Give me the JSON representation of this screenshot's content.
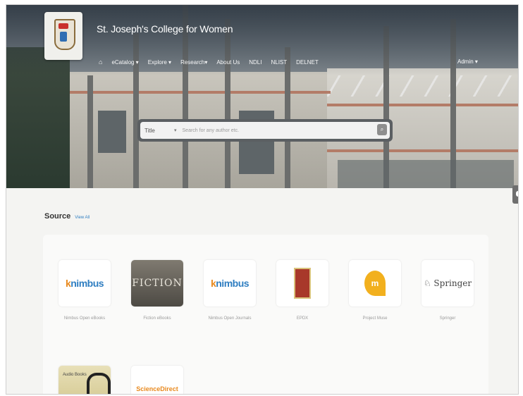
{
  "header": {
    "site_title": "St. Joseph's College for Women",
    "nav": [
      "eCatalog ▾",
      "Explore ▾",
      "Research▾",
      "About Us",
      "NDLI",
      "NLIST",
      "DELNET"
    ],
    "user_menu": "Admin ▾"
  },
  "search": {
    "field_label": "Title",
    "placeholder": "Search for any author etc."
  },
  "source": {
    "heading": "Source",
    "view_all": "View All",
    "items": [
      {
        "label": "Nimbus Open eBooks",
        "logo": "knimbus"
      },
      {
        "label": "Fiction eBooks",
        "logo": "FICTION"
      },
      {
        "label": "Nimbus Open Journals",
        "logo": "knimbus"
      },
      {
        "label": "EPDX",
        "logo": "epdx"
      },
      {
        "label": "Project Muse",
        "logo": "project-muse"
      },
      {
        "label": "Springer",
        "logo": "Springer"
      },
      {
        "label": "",
        "logo": "Audio Books"
      },
      {
        "label": "",
        "logo": "ScienceDirect"
      }
    ]
  },
  "colors": {
    "accent": "#2f7ec1",
    "knimbus_orange": "#e8891e"
  }
}
